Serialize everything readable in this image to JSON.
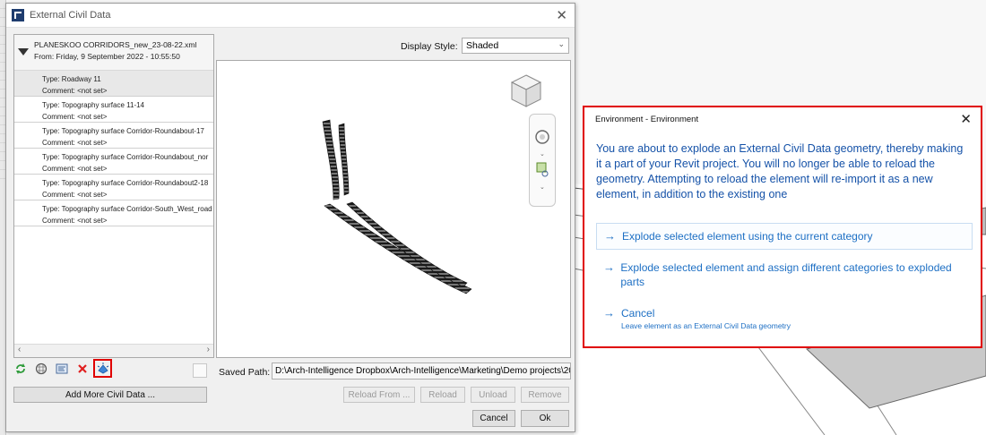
{
  "main_dialog": {
    "title": "External Civil Data",
    "display_style_label": "Display Style:",
    "display_style_value": "Shaded",
    "file": {
      "name": "PLANESKOO CORRIDORS_new_23-08-22.xml",
      "from": "From:  Friday, 9 September 2022 - 10:55:50"
    },
    "items": [
      {
        "type": "Type:  Roadway 11",
        "comment": "Comment:  <not set>"
      },
      {
        "type": "Type:  Topography surface 11-14",
        "comment": "Comment:  <not set>"
      },
      {
        "type": "Type:  Topography surface Corridor-Roundabout-17",
        "comment": "Comment:  <not set>"
      },
      {
        "type": "Type:  Topography surface Corridor-Roundabout_nor",
        "comment": "Comment:  <not set>"
      },
      {
        "type": "Type:  Topography surface Corridor-Roundabout2-18",
        "comment": "Comment:  <not set>"
      },
      {
        "type": "Type:  Topography surface Corridor-South_West_road",
        "comment": "Comment:  <not set>"
      }
    ],
    "toolbar_icons": [
      "refresh-icon",
      "materials-icon",
      "properties-icon",
      "delete-icon",
      "explode-icon"
    ],
    "add_more_label": "Add More Civil Data ...",
    "saved_path_label": "Saved Path:",
    "saved_path_value": "D:\\Arch-Intelligence Dropbox\\Arch-Intelligence\\Marketing\\Demo projects\\20",
    "buttons": {
      "reload_from": "Reload From ...",
      "reload": "Reload",
      "unload": "Unload",
      "remove": "Remove",
      "cancel": "Cancel",
      "ok": "Ok"
    }
  },
  "task_dialog": {
    "title": "Environment - Environment",
    "message": "You are about to explode an External Civil Data geometry, thereby making it a part of your Revit project. You will no longer be able to reload the geometry. Attempting to reload the element will re-import it as a new element, in addition to the existing one",
    "options": [
      {
        "label": "Explode selected element using the current category",
        "sub": ""
      },
      {
        "label": "Explode selected element and assign different categories to exploded parts",
        "sub": ""
      },
      {
        "label": "Cancel",
        "sub": "Leave element as an External Civil Data geometry"
      }
    ]
  },
  "colors": {
    "accent_blue": "#1d6fc4",
    "highlight_red": "#e00000"
  }
}
